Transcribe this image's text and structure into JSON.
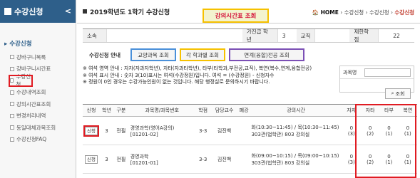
{
  "sidebar": {
    "title": "수강신청",
    "chevron": "<",
    "group": "수강신청",
    "items": [
      {
        "label": "강바구니목록"
      },
      {
        "label": "강바구니시간표"
      },
      {
        "label": "수강신청"
      },
      {
        "label": "수강내역조회"
      },
      {
        "label": "강의시간표조회"
      },
      {
        "label": "변경처리내역"
      },
      {
        "label": "동일대체과목조회"
      },
      {
        "label": "수강신청FAQ"
      }
    ]
  },
  "header": {
    "title": "2019학년도 1학기 수강신청",
    "breadcrumb_home": "HOME",
    "breadcrumb_1": "수강신청",
    "breadcrumb_2": "수강신청",
    "breadcrumb_last": "수강신청"
  },
  "popup_label": "강의시간표 조회",
  "info": {
    "dept_label": "소속",
    "year_label": "가진급 학년",
    "year_value": "3",
    "type_label": "교직",
    "limit_label": "제한학점",
    "limit_value": "22"
  },
  "tabs": [
    {
      "label": "수강신청 안내"
    },
    {
      "label": "교양과목 조회"
    },
    {
      "label": "각 학과별 조회"
    },
    {
      "label": "연계(융합)전공 조회"
    }
  ],
  "notice": {
    "line1": "※ 여석 영역 안내 : 자자(자과자학년), 자타(자과타학년), 타부(타학과,부전공,교직), 복연(복수,연계,융합전공)",
    "line2": "※ 여석 표시 안내 : 숫자 3(10)표시는 여석(수강정원)입니다. 여석 = (수강정원) - 신청자수",
    "line3": "※ 정원이 0인 경우는 수강가능인원이 없는 것입니다. 해당 행정실로 문의하시기 바랍니다."
  },
  "course_search": {
    "label": "과목명",
    "button": "조회"
  },
  "table": {
    "headers": [
      "신청",
      "학년",
      "구분",
      "과목명/과목번호",
      "학점",
      "담당교수",
      "폐강",
      "강의시간",
      "자자",
      "자타",
      "타부",
      "복연"
    ],
    "rows": [
      {
        "apply": "신청",
        "grade": "3",
        "kind": "전필",
        "course": "경영과학(영어A강의)",
        "code": "[01201-02]",
        "credit": "3-3",
        "prof": "김진백",
        "closed": "",
        "time1": "화(10:30~11:45) / 목(10:30~11:45)",
        "time2": "303관(법학관) 803 강의실",
        "c1": "0",
        "c1b": "(3)",
        "c2": "0",
        "c2b": "(2)",
        "c3": "0",
        "c3b": "(1)",
        "c4": "0",
        "c4b": "(1)"
      },
      {
        "apply": "신청",
        "grade": "3",
        "kind": "전필",
        "course": "경영과학",
        "code": "[01201-01]",
        "credit": "3-3",
        "prof": "김진백",
        "closed": "",
        "time1": "화(09:00~10:15) / 목(09:00~10:15)",
        "time2": "303관(법학관) 803 강의실",
        "c1": "0",
        "c1b": "(3)",
        "c2": "0",
        "c2b": "(2)",
        "c3": "0",
        "c3b": "(1)",
        "c4": "0",
        "c4b": "(1)"
      }
    ]
  }
}
